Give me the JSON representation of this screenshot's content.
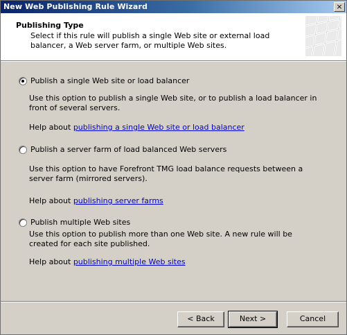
{
  "window": {
    "title": "New Web Publishing Rule Wizard",
    "close_label": "×"
  },
  "header": {
    "title": "Publishing Type",
    "description": "Select if this rule will publish a single Web site or external load balancer, a Web server farm, or multiple Web sites."
  },
  "options": [
    {
      "label": "Publish a single Web site or load balancer",
      "selected": true,
      "description": "Use this option to publish a single Web site, or to publish a load balancer in front of several servers.",
      "help_prefix": "Help about ",
      "help_link": "publishing a single Web site or load balancer"
    },
    {
      "label": "Publish a server farm of load balanced Web servers",
      "selected": false,
      "description": "Use this option to have Forefront TMG load balance requests between a server farm (mirrored servers).",
      "help_prefix": "Help about ",
      "help_link": "publishing server farms"
    },
    {
      "label": "Publish multiple Web sites",
      "selected": false,
      "description": "Use this option to publish more than one Web site. A new rule will be created for each site published.",
      "help_prefix": "Help about ",
      "help_link": "publishing multiple Web sites"
    }
  ],
  "buttons": {
    "back": "< Back",
    "next": "Next >",
    "cancel": "Cancel"
  }
}
